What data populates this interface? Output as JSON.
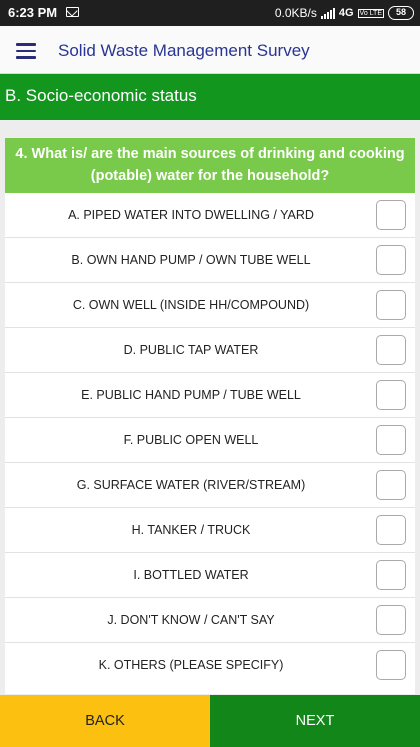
{
  "status_bar": {
    "time": "6:23 PM",
    "network_speed": "0.0KB/s",
    "network_type": "4G",
    "volte": "Vo LTE",
    "battery": "58",
    "notification_icon": "mail-icon"
  },
  "app_bar": {
    "menu_icon": "hamburger-menu-icon",
    "title": "Solid Waste Management Survey"
  },
  "section": {
    "title": "B. Socio-economic status"
  },
  "question": {
    "text": "4. What is/ are the main sources of drinking and cooking (potable) water for the household?",
    "options": [
      {
        "label": "A. PIPED WATER INTO DWELLING / YARD",
        "checked": false
      },
      {
        "label": "B. OWN HAND PUMP / OWN TUBE WELL",
        "checked": false
      },
      {
        "label": "C. OWN WELL (INSIDE HH/COMPOUND)",
        "checked": false
      },
      {
        "label": "D. PUBLIC TAP WATER",
        "checked": false
      },
      {
        "label": "E. PUBLIC HAND PUMP / TUBE WELL",
        "checked": false
      },
      {
        "label": "F. PUBLIC OPEN WELL",
        "checked": false
      },
      {
        "label": "G. SURFACE WATER (RIVER/STREAM)",
        "checked": false
      },
      {
        "label": "H. TANKER / TRUCK",
        "checked": false
      },
      {
        "label": "I. BOTTLED WATER",
        "checked": false
      },
      {
        "label": "J. DON'T KNOW / CAN'T SAY",
        "checked": false
      },
      {
        "label": "K. OTHERS (PLEASE SPECIFY)",
        "checked": false
      }
    ]
  },
  "footer": {
    "back_label": "BACK",
    "next_label": "NEXT"
  },
  "colors": {
    "section_green": "#13961e",
    "question_green": "#79c94a",
    "back_yellow": "#fbc010",
    "next_green": "#13861a",
    "title_blue": "#283593"
  }
}
